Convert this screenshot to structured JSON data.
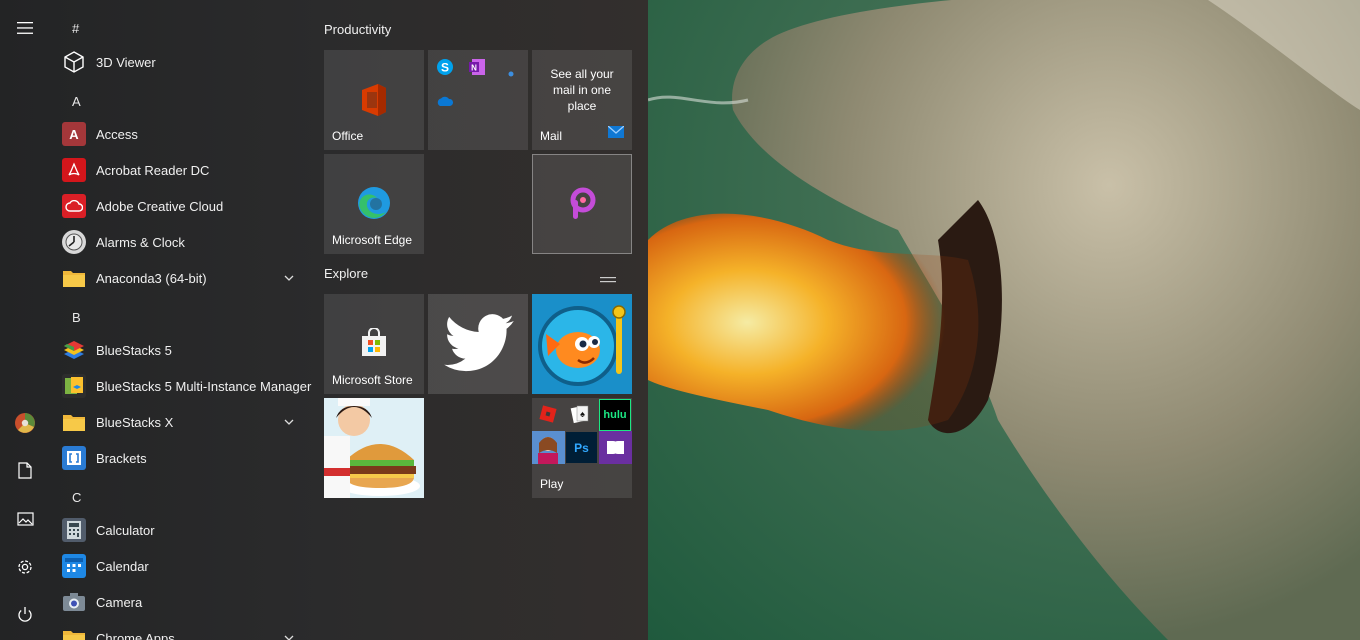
{
  "rail": {
    "icons": [
      "hamburger-icon",
      "user-avatar",
      "documents-icon",
      "pictures-icon",
      "settings-icon",
      "power-icon"
    ]
  },
  "app_list": {
    "sections": [
      {
        "letter": "#",
        "apps": [
          {
            "label": "3D Viewer",
            "icon": "cube-icon"
          }
        ]
      },
      {
        "letter": "A",
        "apps": [
          {
            "label": "Access",
            "icon": "access-icon"
          },
          {
            "label": "Acrobat Reader DC",
            "icon": "acrobat-icon"
          },
          {
            "label": "Adobe Creative Cloud",
            "icon": "creative-cloud-icon"
          },
          {
            "label": "Alarms & Clock",
            "icon": "alarm-clock-icon"
          },
          {
            "label": "Anaconda3 (64-bit)",
            "icon": "folder-icon",
            "expandable": true
          }
        ]
      },
      {
        "letter": "B",
        "apps": [
          {
            "label": "BlueStacks 5",
            "icon": "bluestacks-icon"
          },
          {
            "label": "BlueStacks 5 Multi-Instance Manager",
            "icon": "bluestacks-multi-icon"
          },
          {
            "label": "BlueStacks X",
            "icon": "folder-icon",
            "expandable": true
          },
          {
            "label": "Brackets",
            "icon": "brackets-icon"
          }
        ]
      },
      {
        "letter": "C",
        "apps": [
          {
            "label": "Calculator",
            "icon": "calculator-icon"
          },
          {
            "label": "Calendar",
            "icon": "calendar-icon"
          },
          {
            "label": "Camera",
            "icon": "camera-icon"
          },
          {
            "label": "Chrome Apps",
            "icon": "folder-icon",
            "expandable": true
          }
        ]
      }
    ]
  },
  "tiles": {
    "groups": [
      {
        "title": "Productivity"
      },
      {
        "title": "Explore"
      }
    ],
    "office": {
      "label": "Office"
    },
    "mail": {
      "label": "Mail",
      "description": "See all your mail in one place"
    },
    "edge": {
      "label": "Microsoft Edge"
    },
    "store": {
      "label": "Microsoft Store"
    },
    "play": {
      "label": "Play",
      "hulu_text": "hulu",
      "ps_text": "Ps"
    }
  },
  "colors": {
    "accent": "#0078d4",
    "tile_bg": "#3c3a39",
    "office_red": "#d83b01"
  }
}
